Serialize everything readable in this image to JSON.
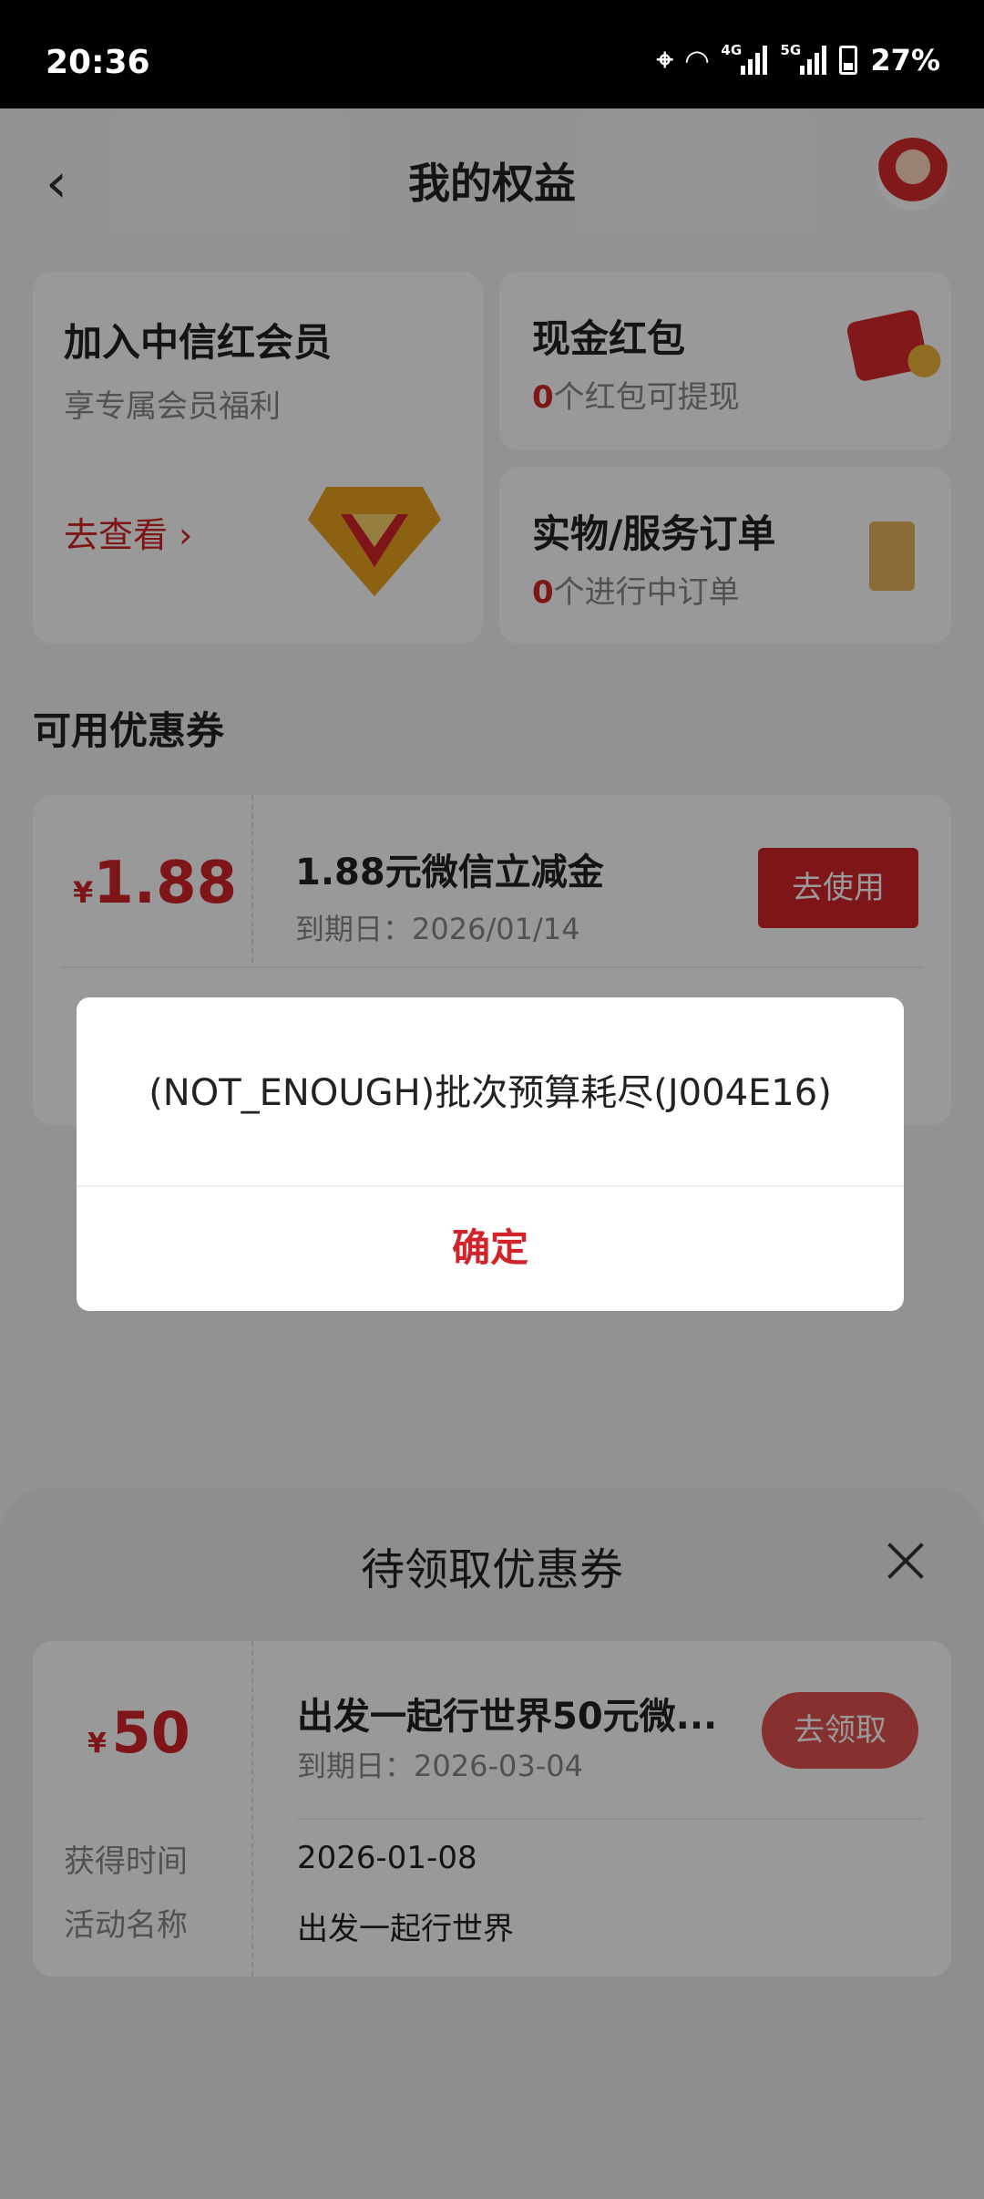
{
  "status_bar": {
    "time": "20:36",
    "battery": "27%",
    "net1": "4G",
    "net2": "5G"
  },
  "header": {
    "title": "我的权益"
  },
  "join": {
    "title": "加入中信红会员",
    "subtitle": "享专属会员福利",
    "link": "去查看 ›"
  },
  "red_packet": {
    "title": "现金红包",
    "count": "0",
    "suffix": "个红包可提现"
  },
  "orders": {
    "title": "实物/服务订单",
    "count": "0",
    "suffix": "个进行中订单"
  },
  "section_available": "可用优惠券",
  "coupon": {
    "currency": "¥",
    "amount": "1.88",
    "name": "1.88元微信立减金",
    "expiry": "到期日：2026/01/14",
    "button": "去使用"
  },
  "sheet": {
    "title": "待领取优惠券",
    "coupon": {
      "currency": "¥",
      "amount": "50",
      "name": "出发一起行世界50元微...",
      "expiry": "到期日：2026-03-04",
      "button": "去领取",
      "obtain_label": "获得时间",
      "obtain_value": "2026-01-08",
      "activity_label": "活动名称",
      "activity_value": "出发一起行世界"
    }
  },
  "dialog": {
    "message": "(NOT_ENOUGH)批次预算耗尽(J004E16)",
    "confirm": "确定"
  },
  "colors": {
    "accent": "#d2232a",
    "overlay": "rgba(0,0,0,0.40)"
  }
}
